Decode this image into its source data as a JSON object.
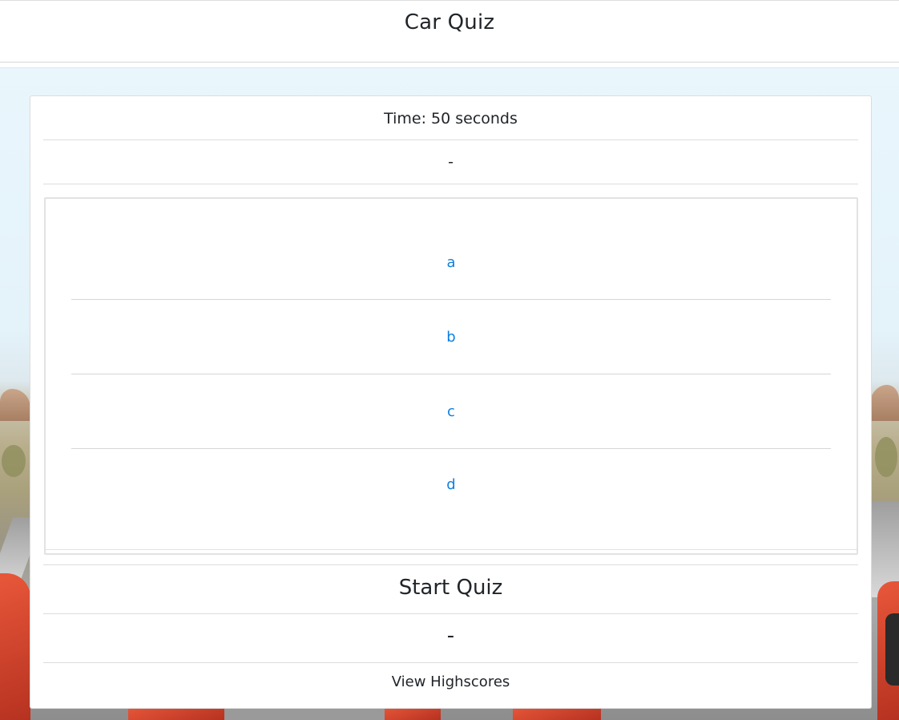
{
  "header": {
    "title": "Car Quiz"
  },
  "quiz": {
    "timer_text": "Time: 50 seconds",
    "feedback_text": "-",
    "answers": [
      {
        "label": "a"
      },
      {
        "label": "b"
      },
      {
        "label": "c"
      },
      {
        "label": "d"
      }
    ],
    "start_label": "Start Quiz",
    "score_text": "-",
    "highscores_label": "View Highscores"
  },
  "colors": {
    "answer_link": "#0d7fe0",
    "text": "#212529",
    "divider": "#dcdcdc"
  }
}
